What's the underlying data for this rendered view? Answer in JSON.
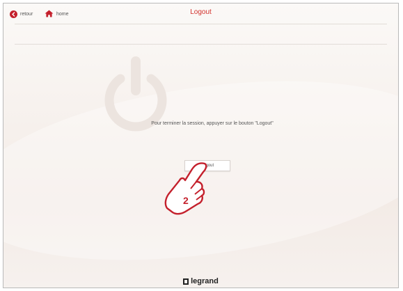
{
  "header": {
    "back_label": "retour",
    "home_label": "home",
    "title": "Logout"
  },
  "main": {
    "message": "Pour terminer la session, appuyer sur le bouton \"Logout\"",
    "logout_button_label": "Logout",
    "callout_number": "2"
  },
  "footer": {
    "brand": "legrand"
  },
  "colors": {
    "accent": "#c4202c",
    "title": "#d2322d",
    "background": "#f6f0ec"
  },
  "icons": [
    "back-arrow-icon",
    "home-icon",
    "power-icon",
    "pointing-hand-icon"
  ]
}
